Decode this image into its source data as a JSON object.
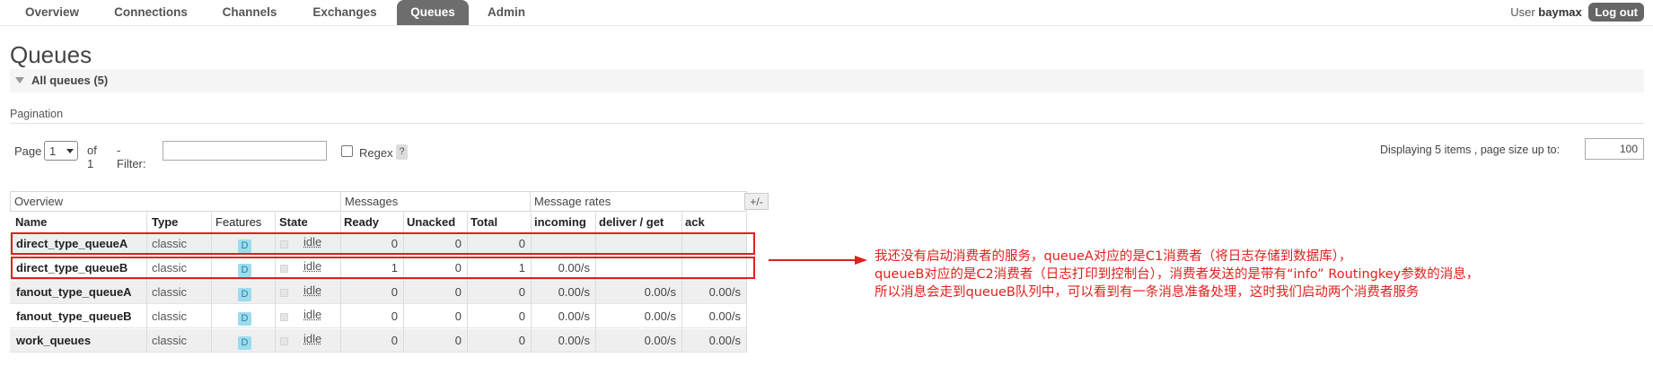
{
  "nav": {
    "tabs": [
      {
        "label": "Overview",
        "active": false
      },
      {
        "label": "Connections",
        "active": false
      },
      {
        "label": "Channels",
        "active": false
      },
      {
        "label": "Exchanges",
        "active": false
      },
      {
        "label": "Queues",
        "active": true
      },
      {
        "label": "Admin",
        "active": false
      }
    ],
    "user_label": "User",
    "user_name": "baymax",
    "logout_label": "Log out"
  },
  "page_title": "Queues",
  "section": {
    "label": "All queues (5)"
  },
  "pagination": {
    "label": "Pagination",
    "page_label": "Page",
    "page_value": "1",
    "of_label": "of 1",
    "filter_label": "- Filter:",
    "filter_value": "",
    "regex_label": "Regex",
    "regex_help": "?",
    "display_info": "Displaying 5 items , page size up to:",
    "page_size": "100"
  },
  "table": {
    "groups": {
      "overview": "Overview",
      "messages": "Messages",
      "rates": "Message rates"
    },
    "toggle_label": "+/-",
    "headers": {
      "name": "Name",
      "type": "Type",
      "features": "Features",
      "state": "State",
      "ready": "Ready",
      "unacked": "Unacked",
      "total": "Total",
      "incoming": "incoming",
      "deliver": "deliver / get",
      "ack": "ack"
    },
    "rows": [
      {
        "name": "direct_type_queueA",
        "type": "classic",
        "feature": "D",
        "state": "idle",
        "ready": "0",
        "unacked": "0",
        "total": "0",
        "incoming": "",
        "deliver": "",
        "ack": ""
      },
      {
        "name": "direct_type_queueB",
        "type": "classic",
        "feature": "D",
        "state": "idle",
        "ready": "1",
        "unacked": "0",
        "total": "1",
        "incoming": "0.00/s",
        "deliver": "",
        "ack": ""
      },
      {
        "name": "fanout_type_queueA",
        "type": "classic",
        "feature": "D",
        "state": "idle",
        "ready": "0",
        "unacked": "0",
        "total": "0",
        "incoming": "0.00/s",
        "deliver": "0.00/s",
        "ack": "0.00/s"
      },
      {
        "name": "fanout_type_queueB",
        "type": "classic",
        "feature": "D",
        "state": "idle",
        "ready": "0",
        "unacked": "0",
        "total": "0",
        "incoming": "0.00/s",
        "deliver": "0.00/s",
        "ack": "0.00/s"
      },
      {
        "name": "work_queues",
        "type": "classic",
        "feature": "D",
        "state": "idle",
        "ready": "0",
        "unacked": "0",
        "total": "0",
        "incoming": "0.00/s",
        "deliver": "0.00/s",
        "ack": "0.00/s"
      }
    ]
  },
  "annotation": {
    "text": "我还没有启动消费者的服务，queueA对应的是C1消费者（将日志存储到数据库），\nqueueB对应的是C2消费者（日志打印到控制台），消费者发送的是带有“info” Routingkey参数的消息，\n所以消息会走到queueB队列中，可以看到有一条消息准备处理，这时我们启动两个消费者服务",
    "color": "#e0201c"
  }
}
